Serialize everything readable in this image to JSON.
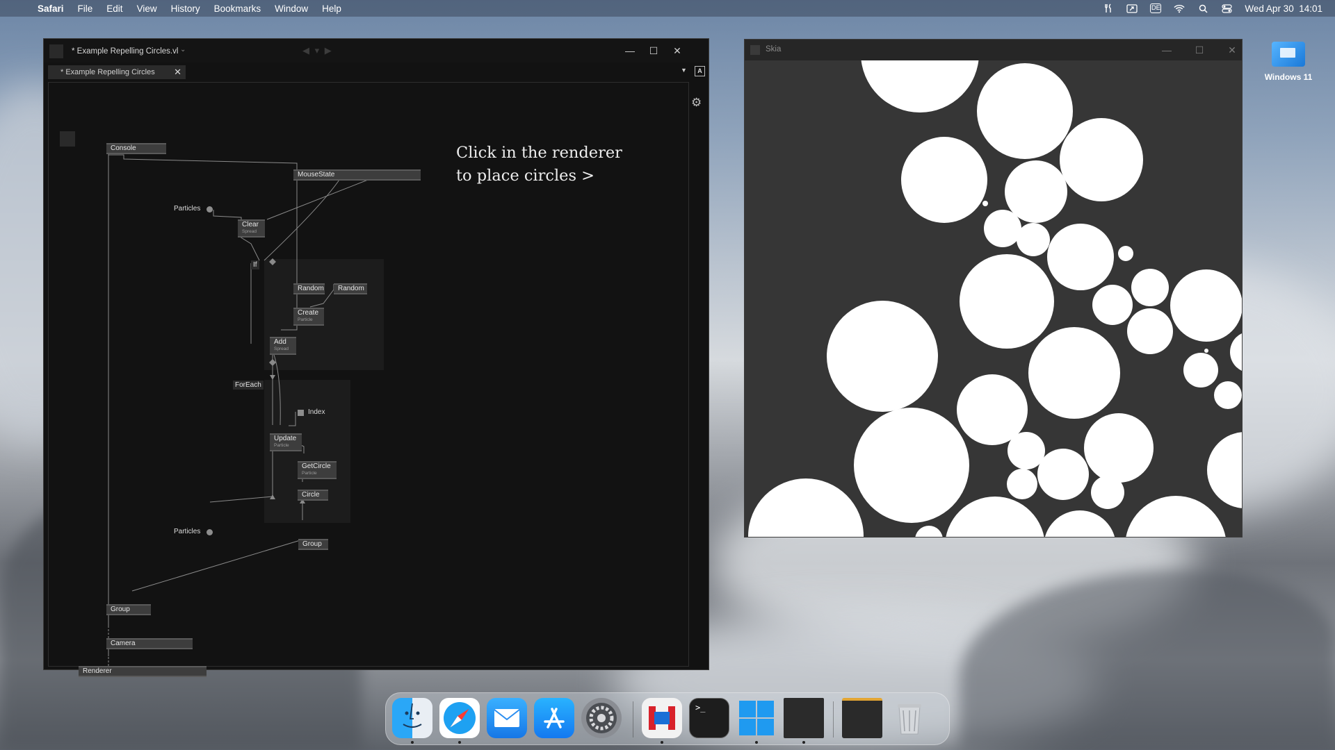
{
  "menubar": {
    "apple_icon": "apple-icon",
    "app_name": "Safari",
    "menus": [
      "File",
      "Edit",
      "View",
      "History",
      "Bookmarks",
      "Window",
      "Help"
    ],
    "keyboard_layout": "DE",
    "datetime": "Wed Apr 30  14:01"
  },
  "editor": {
    "window_title": "* Example Repelling Circles.vl",
    "title_dropdown": "⌄",
    "nav_arrows": "◀ ▾ ▶",
    "tab_label": "* Example Repelling Circles",
    "tab_close": "✕",
    "tab_dropdown": "▼",
    "a_button": "A",
    "hint_line1": "Click in the renderer",
    "hint_line2": "to place circles >",
    "nodes": {
      "console": "Console",
      "mousestate": "MouseState",
      "clear": "Clear",
      "clear_sub": "Spread",
      "if": "If",
      "random1": "Random",
      "random2": "Random",
      "create": "Create",
      "create_sub": "Particle",
      "add": "Add",
      "add_sub": "Spread",
      "foreach": "ForEach",
      "index": "Index",
      "update": "Update",
      "update_sub": "Particle",
      "getcircle": "GetCircle",
      "getcircle_sub": "Particle",
      "circle": "Circle",
      "group_inner": "Group",
      "group_outer": "Group",
      "camera": "Camera",
      "renderer": "Renderer",
      "particles_top": "Particles",
      "particles_bottom": "Particles"
    }
  },
  "skia": {
    "window_title": "Skia"
  },
  "window_controls": {
    "minimize": "—",
    "maximize": "☐",
    "close": "✕"
  },
  "desktop": {
    "vm_label": "Windows 11"
  },
  "dock": {
    "items": [
      "finder-icon",
      "safari-icon",
      "mail-icon",
      "app-store-icon",
      "system-settings-icon",
      "parallels-icon",
      "terminal-icon",
      "windows-icon",
      "vvvv-app-icon",
      "folder-icon",
      "trash-icon"
    ],
    "terminal_glyph": ">_"
  },
  "colors": {
    "editor_bg": "#121212",
    "node_bg": "#3d3d3d",
    "renderer_bg": "#363636",
    "circle_fill": "#ffffff",
    "accent_blue": "#1978d8"
  }
}
